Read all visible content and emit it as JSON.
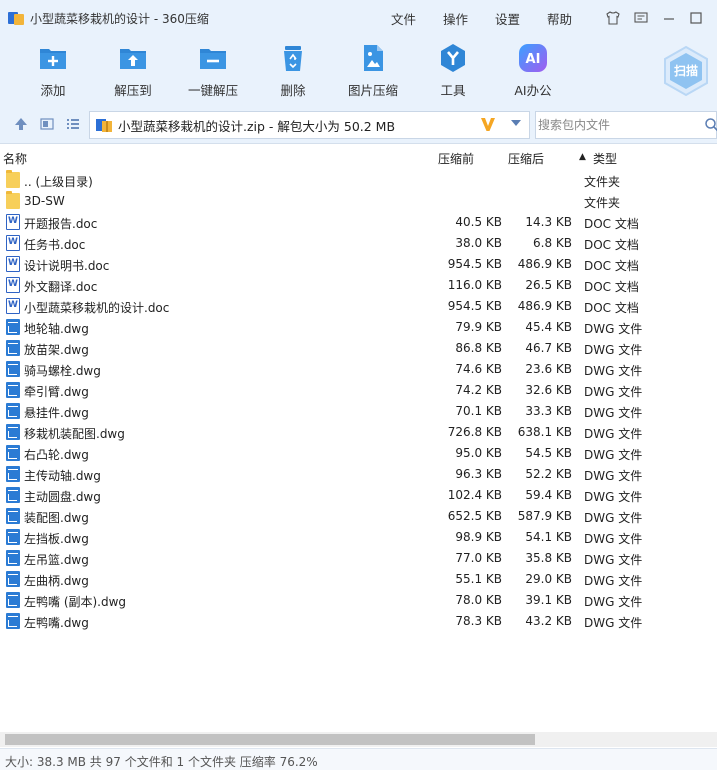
{
  "window": {
    "title": "小型蔬菜移栽机的设计 - 360压缩"
  },
  "title_menu": {
    "file": "文件",
    "ops": "操作",
    "settings": "设置",
    "help": "帮助"
  },
  "toolbar": {
    "add": "添加",
    "extract_to": "解压到",
    "one_click_extract": "一键解压",
    "delete": "删除",
    "image_compress": "图片压缩",
    "tools": "工具",
    "ai_office": "AI办公",
    "ai_icon_text": "AI",
    "scan": "扫描"
  },
  "addressbar": {
    "path": "小型蔬菜移栽机的设计.zip - 解包大小为 50.2 MB",
    "search_placeholder": "搜索包内文件"
  },
  "list_header": {
    "name": "名称",
    "size": "压缩前",
    "packed": "压缩后",
    "type": "类型",
    "sort_arrow": "▲"
  },
  "files": [
    {
      "name": ".. (上级目录)",
      "size": "",
      "packed": "",
      "type": "文件夹",
      "icon": "folder-icon"
    },
    {
      "name": "3D-SW",
      "size": "",
      "packed": "",
      "type": "文件夹",
      "icon": "folder-icon"
    },
    {
      "name": "开题报告.doc",
      "size": "40.5 KB",
      "packed": "14.3 KB",
      "type": "DOC 文档",
      "icon": "word-doc-icon"
    },
    {
      "name": "任务书.doc",
      "size": "38.0 KB",
      "packed": "6.8 KB",
      "type": "DOC 文档",
      "icon": "word-doc-icon"
    },
    {
      "name": "设计说明书.doc",
      "size": "954.5 KB",
      "packed": "486.9 KB",
      "type": "DOC 文档",
      "icon": "word-doc-icon"
    },
    {
      "name": "外文翻译.doc",
      "size": "116.0 KB",
      "packed": "26.5 KB",
      "type": "DOC 文档",
      "icon": "word-doc-icon"
    },
    {
      "name": "小型蔬菜移栽机的设计.doc",
      "size": "954.5 KB",
      "packed": "486.9 KB",
      "type": "DOC 文档",
      "icon": "word-doc-icon"
    },
    {
      "name": "地轮轴.dwg",
      "size": "79.9 KB",
      "packed": "45.4 KB",
      "type": "DWG 文件",
      "icon": "dwg-file-icon"
    },
    {
      "name": "放苗架.dwg",
      "size": "86.8 KB",
      "packed": "46.7 KB",
      "type": "DWG 文件",
      "icon": "dwg-file-icon"
    },
    {
      "name": "骑马螺栓.dwg",
      "size": "74.6 KB",
      "packed": "23.6 KB",
      "type": "DWG 文件",
      "icon": "dwg-file-icon"
    },
    {
      "name": "牵引臂.dwg",
      "size": "74.2 KB",
      "packed": "32.6 KB",
      "type": "DWG 文件",
      "icon": "dwg-file-icon"
    },
    {
      "name": "悬挂件.dwg",
      "size": "70.1 KB",
      "packed": "33.3 KB",
      "type": "DWG 文件",
      "icon": "dwg-file-icon"
    },
    {
      "name": "移栽机装配图.dwg",
      "size": "726.8 KB",
      "packed": "638.1 KB",
      "type": "DWG 文件",
      "icon": "dwg-file-icon"
    },
    {
      "name": "右凸轮.dwg",
      "size": "95.0 KB",
      "packed": "54.5 KB",
      "type": "DWG 文件",
      "icon": "dwg-file-icon"
    },
    {
      "name": "主传动轴.dwg",
      "size": "96.3 KB",
      "packed": "52.2 KB",
      "type": "DWG 文件",
      "icon": "dwg-file-icon"
    },
    {
      "name": "主动圆盘.dwg",
      "size": "102.4 KB",
      "packed": "59.4 KB",
      "type": "DWG 文件",
      "icon": "dwg-file-icon"
    },
    {
      "name": "装配图.dwg",
      "size": "652.5 KB",
      "packed": "587.9 KB",
      "type": "DWG 文件",
      "icon": "dwg-file-icon"
    },
    {
      "name": "左挡板.dwg",
      "size": "98.9 KB",
      "packed": "54.1 KB",
      "type": "DWG 文件",
      "icon": "dwg-file-icon"
    },
    {
      "name": "左吊篮.dwg",
      "size": "77.0 KB",
      "packed": "35.8 KB",
      "type": "DWG 文件",
      "icon": "dwg-file-icon"
    },
    {
      "name": "左曲柄.dwg",
      "size": "55.1 KB",
      "packed": "29.0 KB",
      "type": "DWG 文件",
      "icon": "dwg-file-icon"
    },
    {
      "name": "左鸭嘴 (副本).dwg",
      "size": "78.0 KB",
      "packed": "39.1 KB",
      "type": "DWG 文件",
      "icon": "dwg-file-icon"
    },
    {
      "name": "左鸭嘴.dwg",
      "size": "78.3 KB",
      "packed": "43.2 KB",
      "type": "DWG 文件",
      "icon": "dwg-file-icon"
    }
  ],
  "status": {
    "text": "大小: 38.3 MB 共 97 个文件和 1 个文件夹 压缩率 76.2%"
  },
  "colors": {
    "chrome_bg": "#e9f2fc",
    "accent_blue": "#2b7bd4",
    "folder_yellow": "#f7cf5a",
    "vip_orange": "#f5a623"
  }
}
